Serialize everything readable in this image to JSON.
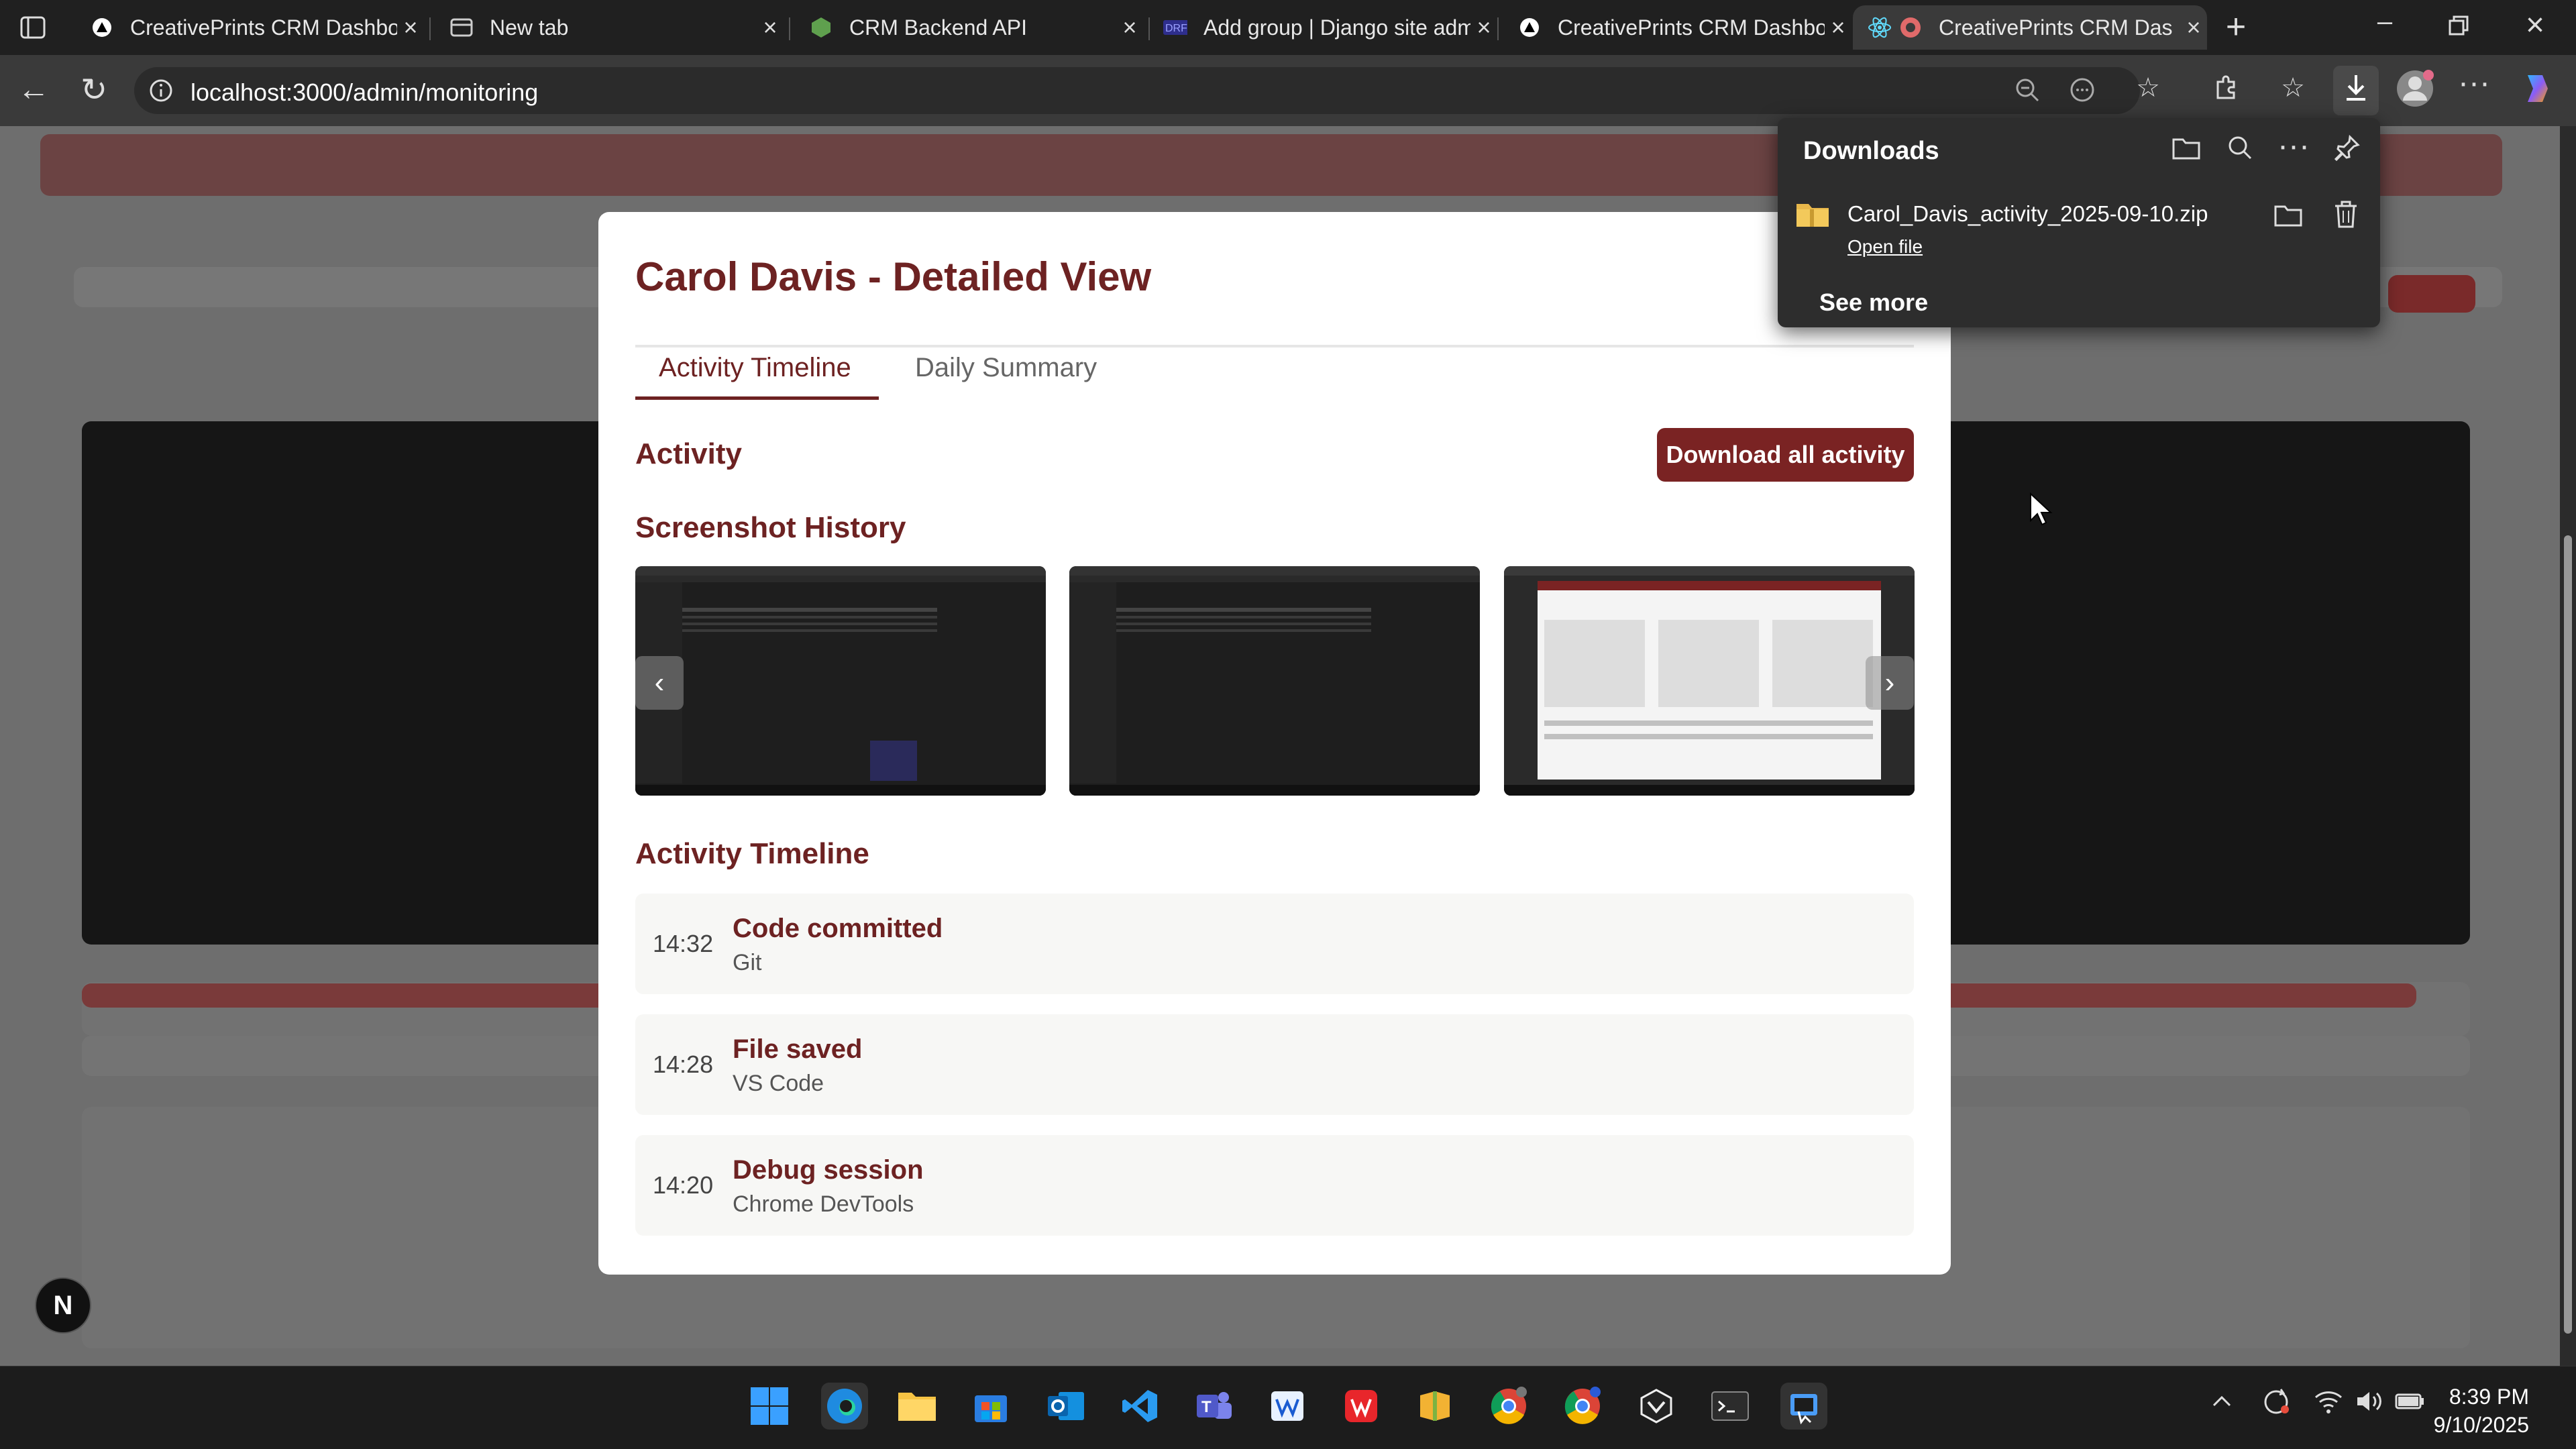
{
  "browser": {
    "tabs": [
      {
        "title": "CreativePrints CRM Dashboard",
        "icon": "triangle-icon"
      },
      {
        "title": "New tab",
        "icon": "newtab-icon"
      },
      {
        "title": "CRM Backend API",
        "icon": "node-icon"
      },
      {
        "title": "Add group | Django site admin",
        "icon": "django-icon"
      },
      {
        "title": "CreativePrints CRM Dashboard",
        "icon": "triangle-icon"
      },
      {
        "title": "CreativePrints CRM Das",
        "icon": "react-icon"
      }
    ],
    "url": "localhost:3000/admin/monitoring"
  },
  "modal": {
    "title": "Carol Davis - Detailed View",
    "tabs": [
      "Activity Timeline",
      "Daily Summary"
    ],
    "activity_heading": "Activity",
    "download_button": "Download all activity",
    "screenshot_heading": "Screenshot History",
    "timeline_heading": "Activity Timeline",
    "timeline": [
      {
        "time": "14:32",
        "title": "Code committed",
        "app": "Git"
      },
      {
        "time": "14:28",
        "title": "File saved",
        "app": "VS Code"
      },
      {
        "time": "14:20",
        "title": "Debug session",
        "app": "Chrome DevTools"
      }
    ]
  },
  "downloads": {
    "title": "Downloads",
    "file_name": "Carol_Davis_activity_2025-09-10.zip",
    "open_file": "Open file",
    "see_more": "See more"
  },
  "floating_button": "N",
  "taskbar": {
    "time": "8:39 PM",
    "date": "9/10/2025"
  },
  "colors": {
    "accent": "#7a2323",
    "title": "#6d2222"
  }
}
